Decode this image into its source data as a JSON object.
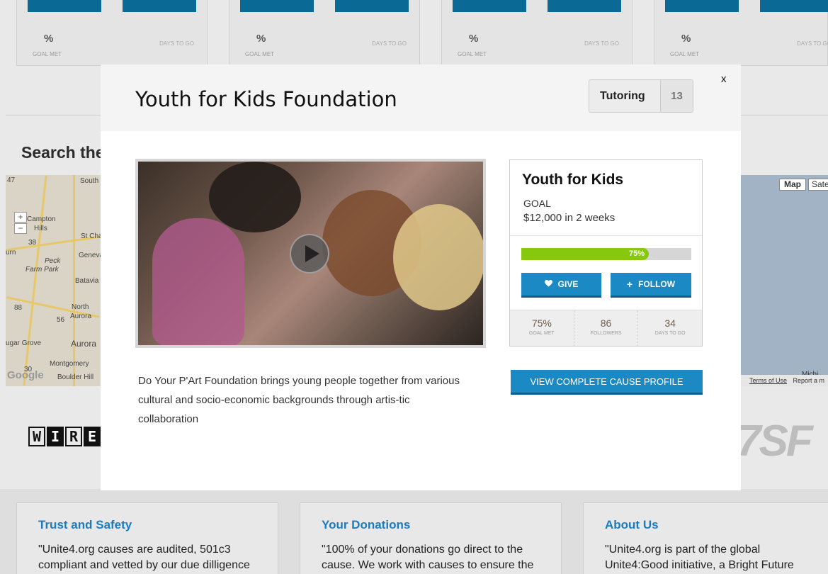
{
  "background": {
    "cards": [
      {
        "pct": "%",
        "goal_met": "GOAL MET",
        "days_to_go": "DAYS TO GO"
      },
      {
        "pct": "%",
        "goal_met": "GOAL MET",
        "days_to_go": "DAYS TO GO"
      },
      {
        "pct": "%",
        "goal_met": "GOAL MET",
        "days_to_go": "DAYS TO GO"
      },
      {
        "pct": "%",
        "goal_met": "GOAL MET",
        "days_to_go": "DAYS TO GO"
      }
    ],
    "search_heading": "Search the",
    "map_left": {
      "labels": [
        "47",
        "South",
        "Campton",
        "Hills",
        "St Charl",
        "38",
        "urn",
        "Geneva",
        "Peck",
        "Farm Park",
        "Batavia",
        "88",
        "North",
        "Aurora",
        "56",
        "ugar Grove",
        "Aurora",
        "30",
        "Montgomery",
        "Boulder Hill",
        "Google"
      ],
      "zoom_in": "+",
      "zoom_out": "−"
    },
    "map_right": {
      "map_button": "Map",
      "satellite_button": "Sate",
      "terms": "Terms of Use",
      "report": "Report a m",
      "michigan": "Michi"
    },
    "wired_letters": [
      "W",
      "I",
      "R",
      "E"
    ],
    "sf_logo": "7SF",
    "footer": [
      {
        "title": "Trust and Safety",
        "text": "\"Unite4.org causes are audited, 501c3 compliant and vetted by our due dilligence"
      },
      {
        "title": "Your Donations",
        "text": "\"100% of your donations go direct to the cause. We work with causes to ensure the"
      },
      {
        "title": "About Us",
        "text": "\"Unite4.org is part of the global Unite4:Good initiative, a Bright Future"
      }
    ]
  },
  "modal": {
    "title": "Youth for Kids Foundation",
    "tag": {
      "label": "Tutoring",
      "count": "13"
    },
    "close_label": "x",
    "description": "Do Your P'Art Foundation brings young people together from various cultural and socio-economic backgrounds through artis-tic collaboration",
    "cause": {
      "name": "Youth for Kids",
      "goal_label": "GOAL",
      "goal_value": "$12,000 in 2 weeks",
      "progress_percent": 75,
      "progress_text": "75%",
      "give_label": "GIVE",
      "follow_label": "FOLLOW",
      "stats": [
        {
          "value": "75%",
          "label": "GOAL MET"
        },
        {
          "value": "86",
          "label": "FOLLOWERS"
        },
        {
          "value": "34",
          "label": "DAYS TO GO"
        }
      ]
    },
    "profile_button": "VIEW COMPLETE CAUSE PROFILE"
  },
  "colors": {
    "accent_blue": "#1a89c4",
    "progress_green": "#86c80e",
    "link_blue": "#1b7bbf"
  }
}
